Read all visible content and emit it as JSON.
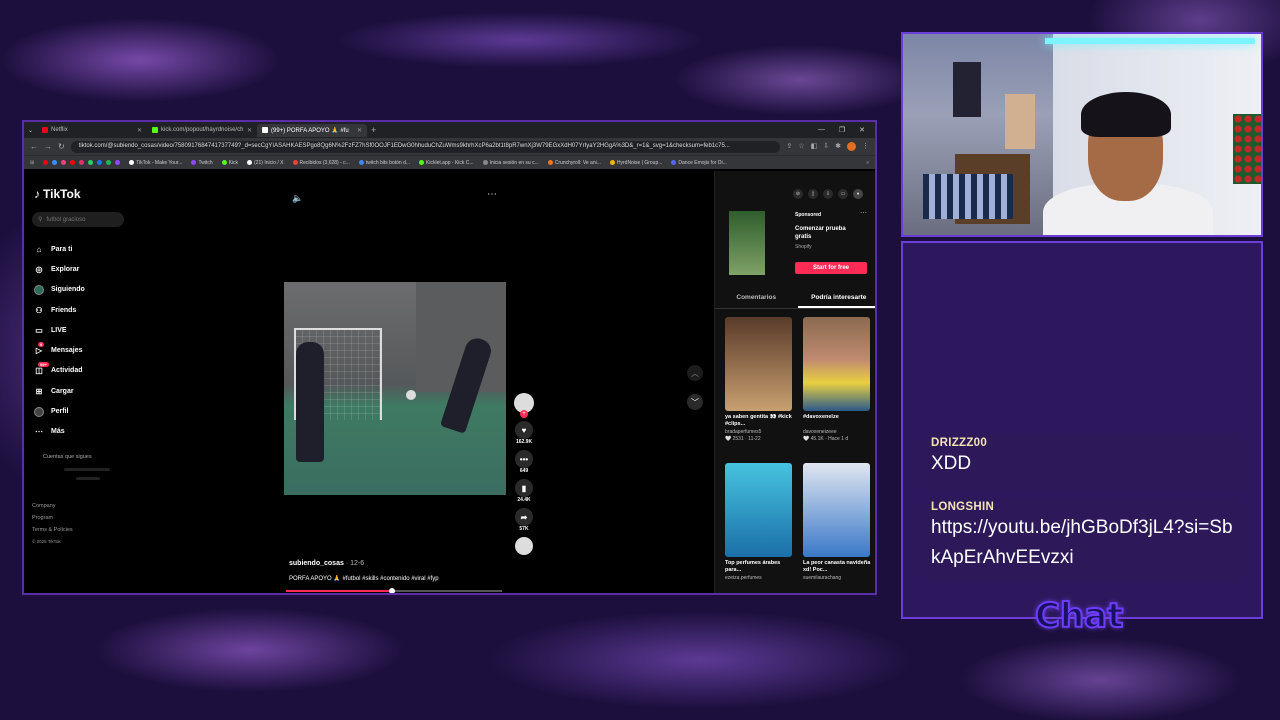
{
  "browser": {
    "tabs": [
      {
        "label": "Netflix",
        "color": "#e50914",
        "active": false
      },
      {
        "label": "kick.com/popout/hayrdnoise/ch",
        "color": "#53fc18",
        "active": false
      },
      {
        "label": "(99+) PORFA APOYO 🙏 #fu",
        "color": "#ffffff",
        "active": true
      }
    ],
    "url": "tiktok.com/@subiendo_cosas/video/7580917684741737749?_d=secCgYIASAHKAESPgo8Qg6N%2FzFZ7hSf0OOJF1EDwG0hhuduChZuWms9khrhXcP6a2bt1t8pR7wnXj3W79EGxXdH07YrIyaY2HGgA%3D&_r=1&_svg=1&checksum=feb1c75...",
    "bookmarks": [
      "TikTok - Make Your...",
      "Twitch",
      "Kick",
      "(21) Inicio / X",
      "Recibidos (3,628) - c...",
      "twitch bits botón d...",
      "Kicklet.app - Kick C...",
      "Inicia sesión en su c...",
      "Crunchyroll: Ve ani...",
      "HyrdNoise | Group...",
      "Dance Emojis for Di..."
    ]
  },
  "tiktok": {
    "logo": "TikTok",
    "search_placeholder": "futbol gracioso",
    "nav": [
      {
        "label": "Para ti",
        "icon": "home-icon",
        "glyph": "⌂"
      },
      {
        "label": "Explorar",
        "icon": "compass-icon",
        "glyph": "◎"
      },
      {
        "label": "Siguiendo",
        "icon": "following-icon",
        "glyph": "●"
      },
      {
        "label": "Friends",
        "icon": "friends-icon",
        "glyph": "⚇"
      },
      {
        "label": "LIVE",
        "icon": "live-icon",
        "glyph": "▭"
      },
      {
        "label": "Mensajes",
        "icon": "message-icon",
        "glyph": "▷",
        "badge": "9"
      },
      {
        "label": "Actividad",
        "icon": "activity-icon",
        "glyph": "◫",
        "badge": "99+"
      },
      {
        "label": "Cargar",
        "icon": "upload-icon",
        "glyph": "⊞"
      },
      {
        "label": "Perfil",
        "icon": "profile-icon",
        "glyph": "●"
      },
      {
        "label": "Más",
        "icon": "more-icon",
        "glyph": "⋯"
      }
    ],
    "following_title": "Cuentas que sigues",
    "footer": [
      "Company",
      "Program",
      "Terms & Policies"
    ],
    "copyright": "© 2025 TikTok",
    "video": {
      "author": "subiendo_cosas",
      "date": "· 12-6",
      "caption": "PORFA APOYO 🙏 #futbol #skills #contenido #viral #fyp",
      "progress": 0.49,
      "likes": "162.9K",
      "comments": "649",
      "saves": "24.4K",
      "shares": "57K"
    },
    "ad": {
      "sponsored": "Sponsored",
      "title": "Comenzar prueba gratis",
      "brand": "Shopify",
      "cta": "Start for free"
    },
    "right_tabs": [
      "Comentarios",
      "Podría interesarte"
    ],
    "cards": [
      {
        "title": "ya saben gentita 👀 #kick #clips...",
        "author": "bradaperfumes5",
        "stats": "🤍 2531 · 11-22",
        "color1": "#5a3a2a",
        "color2": "#c8a070"
      },
      {
        "title": "#davoxenelze",
        "author": "davoxeneizeee",
        "stats": "🤍 45.1K · Hace 1 d",
        "color1": "#e8d040",
        "color2": "#8a6a50"
      },
      {
        "title": "Top perfumes árabes para...",
        "author": "ezeiza.perfumes",
        "stats": "",
        "color1": "#1b6fa8",
        "color2": "#46c3e0"
      },
      {
        "title": "La peor canasta navideña xd! Poc...",
        "author": "suemilaurachang",
        "stats": "",
        "color1": "#3a78c8",
        "color2": "#e0e6f0"
      }
    ]
  },
  "chat": {
    "messages": [
      {
        "user": "DRIZZZ00",
        "text": "XDD"
      },
      {
        "user": "LONGSHIN",
        "text": "https://youtu.be/jhGBoDf3jL4?si=SbkApErAhvEEvzxi"
      }
    ],
    "label": "Chat"
  }
}
